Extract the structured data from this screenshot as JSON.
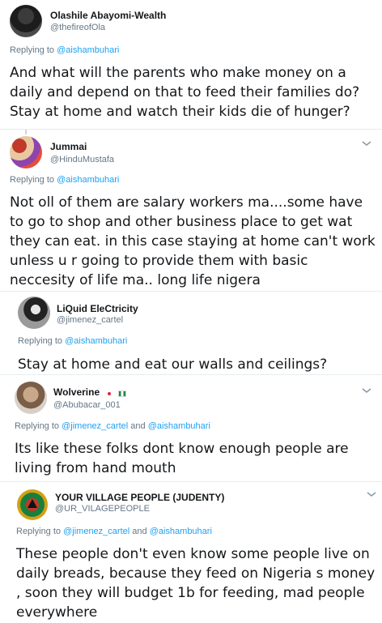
{
  "tweets": [
    {
      "name": "Olashile Abayomi-Wealth",
      "handle": "@thefireofOla",
      "replying_prefix": "Replying to",
      "mentions": [
        "@aishambuhari"
      ],
      "body": "And what will the parents who make money on a daily and depend on that to feed their families do?  Stay at home and watch their kids die of hunger?"
    },
    {
      "name": "Jummai",
      "handle": "@HinduMustafa",
      "replying_prefix": "Replying to",
      "mentions": [
        "@aishambuhari"
      ],
      "body": "Not oll of them are salary workers ma....some have to go to shop and other business place to get wat they can eat. in this case staying at home can't work unless u r going to provide them with basic neccesity of life ma.. long life nigera"
    },
    {
      "name": "LiQuid EleCtricity",
      "handle": "@jimenez_cartel",
      "replying_prefix": "Replying to",
      "mentions": [
        "@aishambuhari"
      ],
      "body": "Stay at home and eat our walls and ceilings?"
    },
    {
      "name": "Wolverine",
      "handle": "@Abubacar_001",
      "replying_prefix": "Replying to",
      "mentions": [
        "@jimenez_cartel",
        "@aishambuhari"
      ],
      "mention_joiner": "and",
      "body": "Its like these folks dont know enough people are living from hand mouth"
    },
    {
      "name": "YOUR VILLAGE PEOPLE (JUDENTY)",
      "handle": "@UR_VILAGEPEOPLE",
      "replying_prefix": "Replying to",
      "mentions": [
        "@jimenez_cartel",
        "@aishambuhari"
      ],
      "mention_joiner": "and",
      "body": "These people  don't even know some people  live on daily breads,  because they feed on Nigeria s money , soon they will budget 1b for feeding,  mad people everywhere"
    }
  ],
  "icons": {
    "caret": "chevron-down-icon",
    "flag_jp": "japan-flag-icon",
    "flag_ng": "nigeria-flag-icon"
  },
  "colors": {
    "link": "#1da1f2",
    "secondary_text": "#657786",
    "separator": "#e6ecf0"
  }
}
